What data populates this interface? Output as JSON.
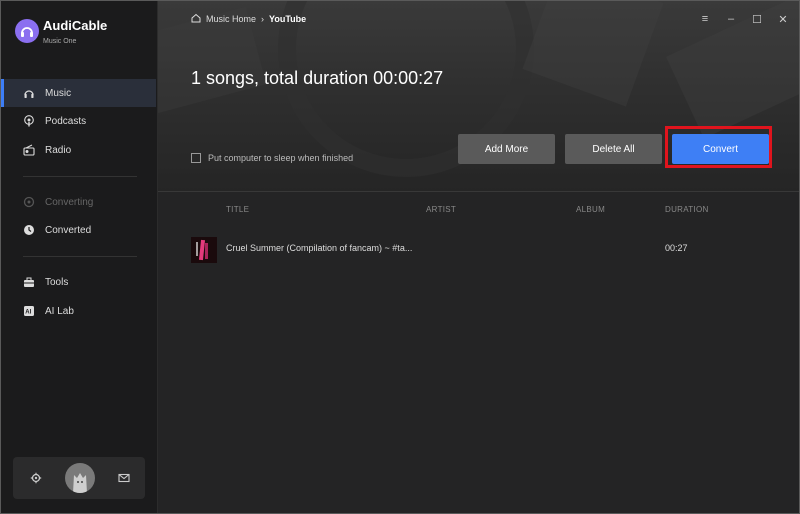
{
  "app": {
    "name": "AudiCable",
    "subtitle": "Music One"
  },
  "sidebar": {
    "items": [
      {
        "label": "Music",
        "icon": "headphones-icon",
        "active": true
      },
      {
        "label": "Podcasts",
        "icon": "podcast-icon"
      },
      {
        "label": "Radio",
        "icon": "radio-icon"
      },
      {
        "label": "Converting",
        "icon": "converting-icon",
        "disabled": true
      },
      {
        "label": "Converted",
        "icon": "clock-icon"
      },
      {
        "label": "Tools",
        "icon": "toolbox-icon"
      },
      {
        "label": "AI Lab",
        "icon": "ai-icon"
      }
    ]
  },
  "header": {
    "breadcrumb_home": "Music Home",
    "breadcrumb_current": "YouTube"
  },
  "main": {
    "summary": "1 songs, total duration 00:00:27",
    "sleep_option": "Put computer to sleep when finished",
    "add_more": "Add More",
    "delete_all": "Delete All",
    "convert": "Convert"
  },
  "table": {
    "columns": [
      "TITLE",
      "ARTIST",
      "ALBUM",
      "DURATION"
    ],
    "rows": [
      {
        "title": "Cruel Summer (Compilation of fancam) ~ #ta...",
        "artist": "",
        "album": "",
        "duration": "00:27"
      }
    ]
  },
  "colors": {
    "accent": "#3e7ff5",
    "highlight": "#e0141d",
    "brand": "#8b6ff0"
  }
}
